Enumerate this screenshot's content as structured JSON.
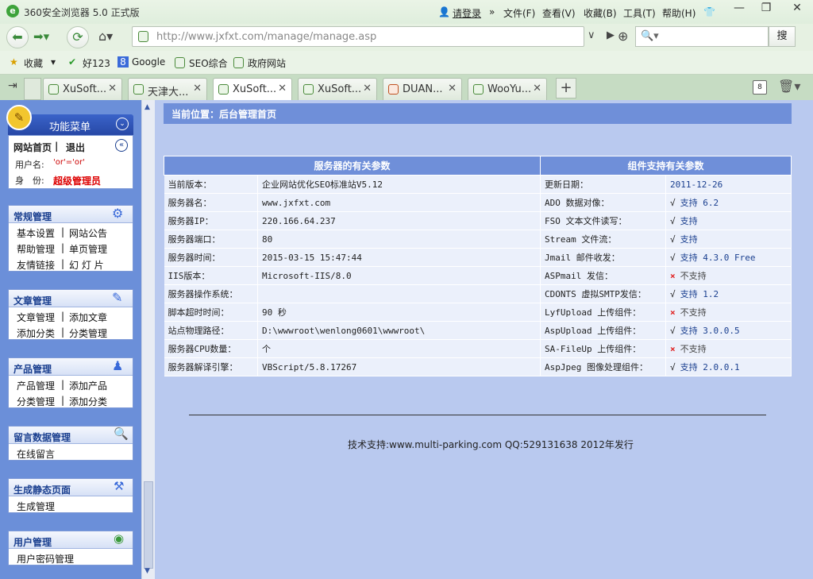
{
  "browser": {
    "title": "360安全浏览器 5.0 正式版",
    "login": "请登录",
    "menus": [
      "文件(F)",
      "查看(V)",
      "收藏(B)",
      "工具(T)",
      "帮助(H)"
    ],
    "address": "http://www.jxfxt.com/manage/manage.asp",
    "search_button": "搜",
    "favorites": [
      "收藏",
      "好123",
      "Google",
      "SEO综合",
      "政府网站"
    ],
    "tabs": [
      {
        "label": "XuSoft..."
      },
      {
        "label": "天津大..."
      },
      {
        "label": "XuSoft...",
        "active": true
      },
      {
        "label": "XuSoft..."
      },
      {
        "label": "DUAN..."
      },
      {
        "label": "WooYu..."
      }
    ],
    "tab_count": "8"
  },
  "sidebar": {
    "menu_title": "功能菜单",
    "home_links": {
      "home": "网站首页",
      "sep": "|",
      "logout": "退出"
    },
    "user_label": "用户名:",
    "user_value": "'or'='or'",
    "role_label": "身　份:",
    "role_value": "超级管理员",
    "sections": [
      {
        "title": "常规管理",
        "rows": [
          [
            "基本设置",
            "网站公告"
          ],
          [
            "帮助管理",
            "单页管理"
          ],
          [
            "友情链接",
            "幻 灯 片"
          ]
        ]
      },
      {
        "title": "文章管理",
        "rows": [
          [
            "文章管理",
            "添加文章"
          ],
          [
            "添加分类",
            "分类管理"
          ]
        ]
      },
      {
        "title": "产品管理",
        "rows": [
          [
            "产品管理",
            "添加产品"
          ],
          [
            "分类管理",
            "添加分类"
          ]
        ]
      },
      {
        "title": "留言数据管理",
        "rows": [
          [
            "在线留言"
          ]
        ]
      },
      {
        "title": "生成静态页面",
        "rows": [
          [
            "生成管理"
          ]
        ]
      },
      {
        "title": "用户管理",
        "rows": [
          [
            "用户密码管理"
          ]
        ]
      }
    ]
  },
  "main": {
    "location": "当前位置：后台管理首页",
    "server_header": "服务器的有关参数",
    "component_header": "组件支持有关参数",
    "server_rows": [
      {
        "label": "当前版本：",
        "value": "企业网站优化SEO标准站V5.12"
      },
      {
        "label": "服务器名：",
        "value": "www.jxfxt.com"
      },
      {
        "label": "服务器IP：",
        "value": "220.166.64.237"
      },
      {
        "label": "服务器端口：",
        "value": "80"
      },
      {
        "label": "服务器时间：",
        "value": "2015-03-15 15:47:44"
      },
      {
        "label": "IIS版本：",
        "value": "Microsoft-IIS/8.0"
      },
      {
        "label": "服务器操作系统：",
        "value": ""
      },
      {
        "label": "脚本超时时间：",
        "value": "90 秒"
      },
      {
        "label": "站点物理路径：",
        "value": "D:\\wwwroot\\wenlong0601\\wwwroot\\"
      },
      {
        "label": "服务器CPU数量：",
        "value": "个"
      },
      {
        "label": "服务器解译引擎：",
        "value": "VBScript/5.8.17267"
      }
    ],
    "component_rows": [
      {
        "label": "更新日期：",
        "mark": "",
        "value": "2011-12-26"
      },
      {
        "label": "ADO 数据对像：",
        "mark": "√",
        "value": "支持 6.2"
      },
      {
        "label": "FSO 文本文件读写：",
        "mark": "√",
        "value": "支持"
      },
      {
        "label": "Stream 文件流：",
        "mark": "√",
        "value": "支持"
      },
      {
        "label": "Jmail 邮件收发：",
        "mark": "√",
        "value": "支持 4.3.0 Free"
      },
      {
        "label": "ASPmail 发信：",
        "mark": "×",
        "value": "不支持"
      },
      {
        "label": "CDONTS 虚拟SMTP发信：",
        "mark": "√",
        "value": "支持 1.2"
      },
      {
        "label": "LyfUpload 上传组件：",
        "mark": "×",
        "value": "不支持"
      },
      {
        "label": "AspUpload 上传组件：",
        "mark": "√",
        "value": "支持 3.0.0.5"
      },
      {
        "label": "SA-FileUp 上传组件：",
        "mark": "×",
        "value": "不支持"
      },
      {
        "label": "AspJpeg 图像处理组件：",
        "mark": "√",
        "value": "支持 2.0.0.1"
      }
    ],
    "footer": "技术支持:www.multi-parking.com QQ:529131638 2012年发行"
  }
}
